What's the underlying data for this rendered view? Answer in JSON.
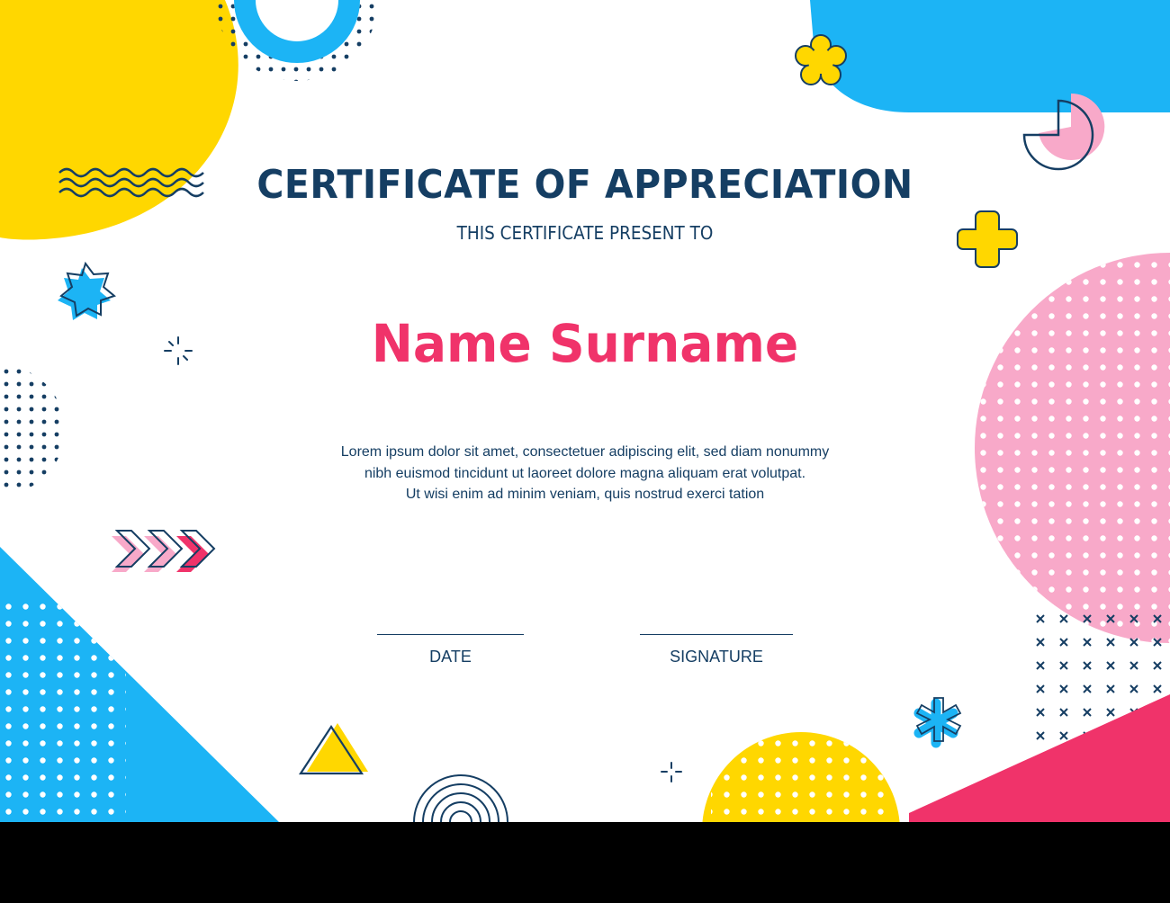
{
  "certificate": {
    "title": "CERTIFICATE OF APPRECIATION",
    "subtitle": "THIS CERTIFICATE PRESENT TO",
    "recipient_name": "Name Surname",
    "body_lines": [
      "Lorem ipsum dolor sit amet, consectetuer adipiscing elit, sed diam nonummy",
      "nibh euismod tincidunt ut laoreet dolore magna aliquam erat volutpat.",
      "Ut wisi enim ad minim veniam, quis nostrud exerci tation"
    ],
    "date_label": "DATE",
    "signature_label": "SIGNATURE"
  },
  "colors": {
    "navy": "#153e63",
    "pink_accent": "#f0336a",
    "yellow": "#ffd700",
    "blue": "#1cb4f5",
    "light_pink": "#f8a9c9",
    "background": "#ffffff",
    "banner": "#000000"
  },
  "decorations": [
    "yellow-blob-top-left",
    "blue-ring-top",
    "blue-blob-top-right",
    "yellow-flower-icon",
    "pink-pie-icon",
    "wavy-lines",
    "yellow-cross-icon",
    "blue-star-icon",
    "sparkle-icon",
    "dot-grid",
    "pink-dotted-circle",
    "chevron-arrows-icon",
    "blue-dotted-triangle",
    "cross-grid",
    "blue-asterisk-icon",
    "triangle-icon",
    "concentric-arcs-icon",
    "yellow-dotted-semicircle",
    "pink-corner-triangle"
  ]
}
